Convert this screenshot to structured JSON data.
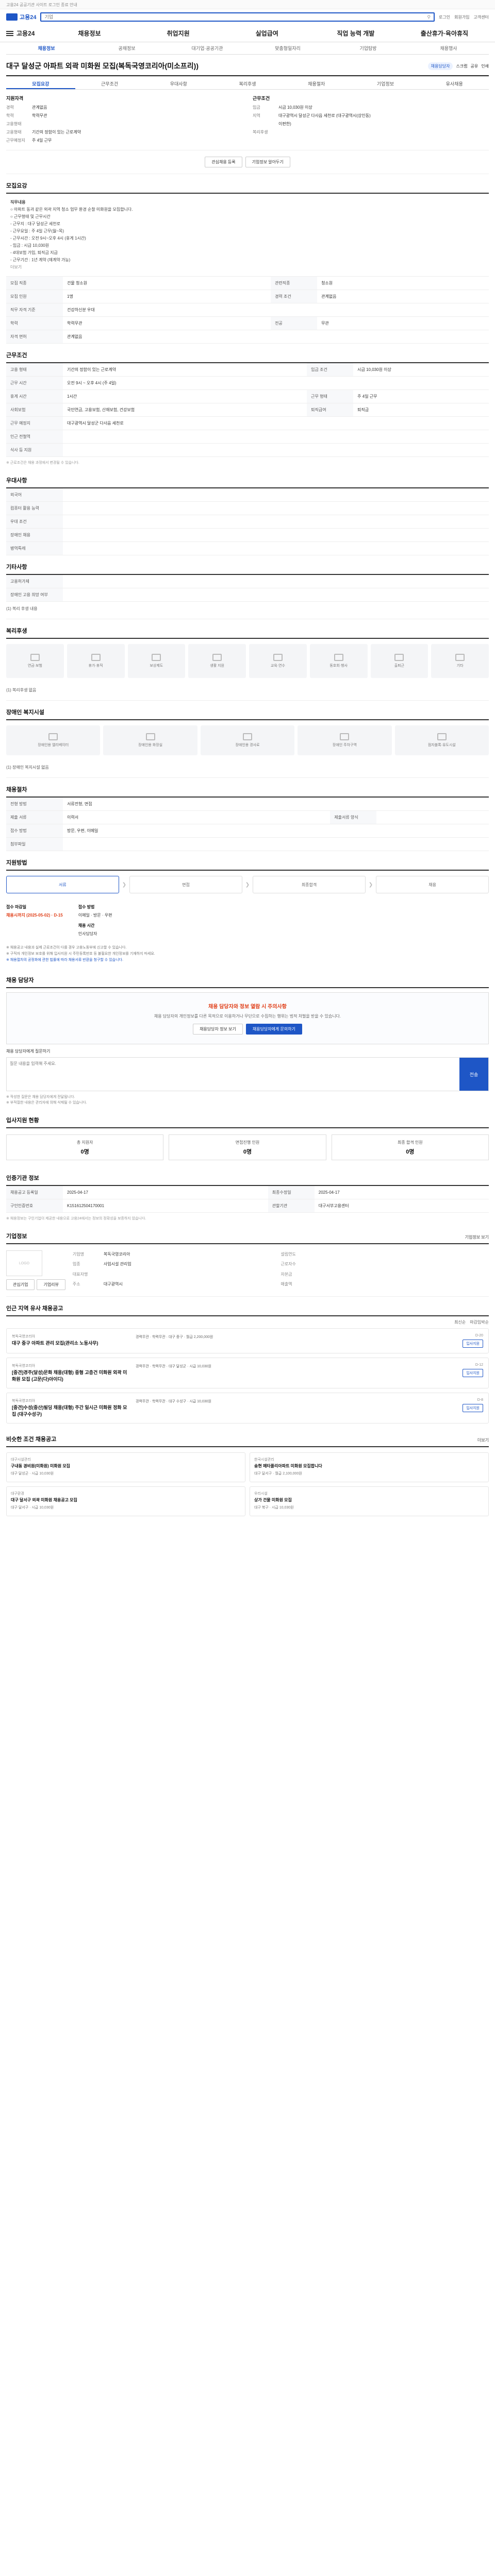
{
  "top_notice": "고용24 공공기관 사이트 로그인 종료 안내",
  "header": {
    "logo": "고용24",
    "search_placeholder": "기업",
    "util": [
      "로그인",
      "회원가입",
      "고객센터"
    ]
  },
  "gnb": {
    "first": "고용24",
    "items": [
      "채용정보",
      "취업지원",
      "실업급여",
      "직업 능력 개발",
      "출산휴가·육아휴직"
    ]
  },
  "page_tabs": [
    "채용정보",
    "공채정보",
    "대기업·공공기관",
    "맞춤형일자리",
    "기업탐방",
    "채용행사"
  ],
  "job": {
    "title": "대구 달성군 아파트 외곽 미화원 모집(복독국영코리아(미소프리))",
    "badge": "채용담당자",
    "actions": [
      "스크랩",
      "공유",
      "인쇄"
    ]
  },
  "sub_tabs": [
    "모집요강",
    "근무조건",
    "우대사항",
    "복리후생",
    "채용절차",
    "기업정보",
    "유사채용"
  ],
  "summary": {
    "left_title": "지원자격",
    "left": [
      {
        "k": "경력",
        "v": "관계없음"
      },
      {
        "k": "학력",
        "v": "학력무관"
      },
      {
        "k": "고용형태",
        "v": ""
      },
      {
        "k": "고용형태",
        "v": "기간의 정함이 있는 근로계약"
      },
      {
        "k": "근무예정지",
        "v": "주 4일 근무"
      }
    ],
    "right_title": "근무조건",
    "right": [
      {
        "k": "임금",
        "v": "시급 10,030원 이상"
      },
      {
        "k": "지역",
        "v": "대구광역시 달성군 다사읍 세천로 (대구광역시(상인동)"
      },
      {
        "k": "",
        "v": "이편한)"
      },
      {
        "k": "복리후생",
        "v": ""
      }
    ]
  },
  "summary_buttons": {
    "left": "관심채용 등록",
    "right": "기업정보 알아두기"
  },
  "section_recruit": {
    "title": "모집요강",
    "desc_label": "직무내용",
    "desc": "○ 아파트 동과 같은 외곽 지역 청소 업무 환경 순찰 미화원을 모집합니다.\n○ 근무형태 및 근무시간\n - 근무지 : 대구 달성군 세천로\n - 근무요일 : 주 4일 근무(월~목)\n - 근무시간 : 오전 9시~오후 4시 (휴게 1시간)\n - 임금 : 시급 10,030원\n - 4대보험 가입, 퇴직금 지급\n - 근무기간 : 1년 계약 (재계약 가능)",
    "more": "더보기",
    "rows": [
      {
        "k": "모집 직종",
        "v": "건물 청소원",
        "k2": "관련직종",
        "v2": "청소원"
      },
      {
        "k": "모집 인원",
        "v": "1명",
        "k2": "경력 조건",
        "v2": "관계없음"
      },
      {
        "k": "직무 자격 기준",
        "v": "건강하신분 우대",
        "k2": "",
        "v2": ""
      },
      {
        "k": "학력",
        "v": "학력무관",
        "k2": "전공",
        "v2": "무관"
      },
      {
        "k": "자격 면허",
        "v": "관계없음",
        "k2": "",
        "v2": ""
      }
    ]
  },
  "section_conditions": {
    "title": "근무조건",
    "rows": [
      {
        "k": "고용 형태",
        "v": "기간의 정함이 있는 근로계약",
        "k2": "임금 조건",
        "v2": "시급 10,030원 이상"
      },
      {
        "k": "근무 시간",
        "v": "오전 9시 ~ 오후 4시 (주 4일)",
        "k2": "",
        "v2": ""
      },
      {
        "k": "휴게 시간",
        "v": "1시간",
        "k2": "근무 형태",
        "v2": "주 4일 근무"
      },
      {
        "k": "사회보험",
        "v": "국민연금, 고용보험, 산재보험, 건강보험",
        "k2": "퇴직급여",
        "v2": "퇴직금"
      },
      {
        "k": "근무 예정지",
        "v": "대구광역시 달성군 다사읍 세천로",
        "k2": "",
        "v2": ""
      },
      {
        "k": "인근 전철역",
        "v": "",
        "k2": "",
        "v2": ""
      },
      {
        "k": "식사 등 지원",
        "v": "",
        "k2": "",
        "v2": ""
      }
    ],
    "note": "※ 근로조건은 채용 과정에서 변경될 수 있습니다."
  },
  "section_prefer": {
    "title": "우대사항",
    "rows": [
      {
        "k": "외국어",
        "v": ""
      },
      {
        "k": "컴퓨터 활용 능력",
        "v": ""
      },
      {
        "k": "우대 조건",
        "v": ""
      },
      {
        "k": "장애인 채용",
        "v": ""
      },
      {
        "k": "병역특례",
        "v": ""
      }
    ]
  },
  "section_other": {
    "title": "기타사항",
    "rows": [
      {
        "k": "고용허가제",
        "v": ""
      },
      {
        "k": "장애인 고용 희망 여부",
        "v": ""
      }
    ],
    "etc": "(1) 복리 후생 내용"
  },
  "section_welfare": {
    "title": "복리후생",
    "items": [
      "연금·보험",
      "휴가·휴직",
      "보상제도",
      "생활 지원",
      "교육·연수",
      "동호회·행사",
      "출퇴근",
      "기타"
    ],
    "etc": "(1) 복리후생 없음"
  },
  "section_disabled": {
    "title": "장애인 복지시설",
    "items": [
      "장애인용 엘리베이터",
      "장애인용 화장실",
      "장애인용 경사로",
      "장애인 주차구역",
      "점자블록·유도시설"
    ],
    "etc": "(1) 장애인 복지시설 없음"
  },
  "section_process": {
    "title": "채용절차",
    "rows": [
      {
        "k": "전형 방법",
        "v": "서류전형, 면접"
      },
      {
        "k": "제출 서류",
        "v": "이력서",
        "k2": "제출서류 양식",
        "v2": ""
      },
      {
        "k": "접수 방법",
        "v": "방문, 우편, 이메일",
        "k2": "",
        "v2": ""
      },
      {
        "k": "첨부파일",
        "v": "",
        "k2": "",
        "v2": ""
      }
    ]
  },
  "section_apply": {
    "title": "지원방법",
    "steps": [
      "서류",
      "면접",
      "최종합격",
      "채용"
    ],
    "deadline_label": "접수 마감일",
    "deadline": "채용시까지 (2025-05-02) · D-15",
    "method_label": "접수 방법",
    "method": "이메일 · 방문 · 우편",
    "contact_label": "채용 시간",
    "contact": "인사담당자",
    "notices": [
      "※ 채용공고 내용과 실제 근로조건이 다를 경우 고용노동부에 신고할 수 있습니다.",
      "※ 구직자 개인정보 보호를 위해 입사지원 시 주민등록번호 등 불필요한 개인정보를 기재하지 마세요.",
      "※ 채용절차의 공정화에 관한 법률에 따라 채용서류 반환을 청구할 수 있습니다."
    ]
  },
  "section_contact": {
    "title": "채용 담당자",
    "warn_title": "채용 담당자와 정보 열람 시 주의사항",
    "warn_desc": "채용 담당자의 개인정보를 다른 목적으로 이용하거나 무단으로 수집하는 행위는 법적 처벌을 받을 수 있습니다.",
    "btn_left": "채용담당자 정보 보기",
    "btn_right": "채용담당자에게 문의하기",
    "qa_label": "채용 담당자에게 질문하기",
    "qa_placeholder": "질문 내용을 입력해 주세요.",
    "qa_send": "전송",
    "qa_notes": [
      "※ 작성한 질문은 채용 담당자에게 전달됩니다.",
      "※ 부적절한 내용은 관리자에 의해 삭제될 수 있습니다."
    ]
  },
  "section_stats": {
    "title": "입사지원 현황",
    "items": [
      {
        "label": "총 지원자",
        "value": "0명"
      },
      {
        "label": "면접진행 인원",
        "value": "0명"
      },
      {
        "label": "최종 합격 인원",
        "value": "0명"
      }
    ]
  },
  "section_manage": {
    "title": "인증기관 정보",
    "rows": [
      {
        "k": "채용공고 등록일",
        "v": "2025-04-17",
        "k2": "최종수정일",
        "v2": "2025-04-17"
      },
      {
        "k": "구인인증번호",
        "v": "K151612504170001",
        "k2": "관할기관",
        "v2": "대구서부고용센터"
      }
    ],
    "note": "※ 채용정보는 구인기업이 제공한 내용으로 고용24에서는 정보의 정확성을 보증하지 않습니다."
  },
  "section_company": {
    "title": "기업정보",
    "btn": "기업정보 보기",
    "logo_alt": "LOGO",
    "rows": [
      {
        "k": "기업명",
        "v": "복독국영코리아",
        "k2": "설립연도",
        "v2": ""
      },
      {
        "k": "업종",
        "v": "사업시설 관리업",
        "k2": "근로자수",
        "v2": ""
      },
      {
        "k": "대표자명",
        "v": "",
        "k2": "자본금",
        "v2": ""
      },
      {
        "k": "주소",
        "v": "대구광역시",
        "k2": "매출액",
        "v2": ""
      }
    ],
    "actions": [
      "관심기업",
      "기업리뷰"
    ]
  },
  "section_similar": {
    "title": "인근 지역 유사 채용공고",
    "filters": [
      "최신순",
      "마감임박순"
    ],
    "jobs": [
      {
        "company": "복독국영코리아",
        "title": "대구 중구 아파트 관리 모집(관리소 노동사무)",
        "meta": "경력무관 · 학력무관 · 대구 중구 · 월급 2,200,000원",
        "deadline": "D-20",
        "apply": "입사지원"
      },
      {
        "company": "복독국영코리아",
        "title": "[중견]경주(달성)문화 채용(대형) 중형 고층건 미화원 외곽 미화원 모집 (고문(다)아이디)",
        "meta": "경력무관 · 학력무관 · 대구 달성군 · 시급 10,030원",
        "deadline": "D-12",
        "apply": "입사지원"
      },
      {
        "company": "복독국영코리아",
        "title": "[중견]수성(중산)빌딩 채용(대형) 주간 일시근 미화원 정화 모집 (대구수성구)",
        "meta": "경력무관 · 학력무관 · 대구 수성구 · 시급 10,030원",
        "deadline": "D-8",
        "apply": "입사지원"
      }
    ]
  },
  "section_recommend": {
    "title": "비슷한 조건 채용공고",
    "more": "더보기",
    "items": [
      {
        "company": "대구시설관리",
        "title": "구내동 경비원(미화원) 미화원 모집",
        "meta": "대구 달성군 · 시급 10,030원"
      },
      {
        "company": "한국시설관리",
        "title": "송현 메타폴리아파트 미화원 모집합니다",
        "meta": "대구 달서구 · 월급 2,100,000원"
      },
      {
        "company": "대구환경",
        "title": "대구 달서구 외곽 미화원 채용공고 모집",
        "meta": "대구 달서구 · 시급 10,030원"
      },
      {
        "company": "우리시설",
        "title": "상가 건물 미화원 모집",
        "meta": "대구 북구 · 시급 10,030원"
      }
    ]
  }
}
